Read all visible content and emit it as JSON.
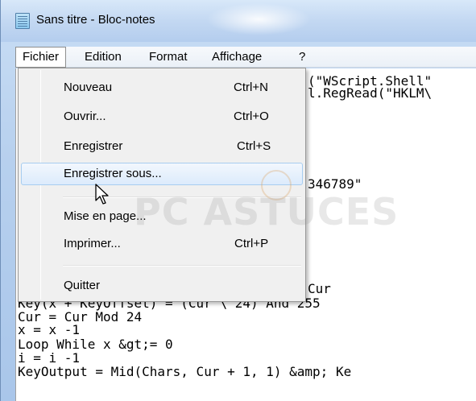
{
  "window": {
    "title": "Sans titre - Bloc-notes"
  },
  "menubar": {
    "items": [
      "Fichier",
      "Edition",
      "Format",
      "Affichage",
      "?"
    ]
  },
  "file_menu": {
    "items": [
      {
        "label": "Nouveau",
        "shortcut": "Ctrl+N"
      },
      {
        "label": "Ouvrir...",
        "shortcut": "Ctrl+O"
      },
      {
        "label": "Enregistrer",
        "shortcut": "Ctrl+S"
      },
      {
        "label": "Enregistrer sous...",
        "shortcut": ""
      },
      {
        "label": "Mise en page...",
        "shortcut": ""
      },
      {
        "label": "Imprimer...",
        "shortcut": "Ctrl+P"
      },
      {
        "label": "Quitter",
        "shortcut": ""
      }
    ],
    "highlighted": "Enregistrer sous..."
  },
  "editor": {
    "lines": [
      "(\"WScript.Shell\"",
      "l.RegRead(\"HKLM\\",
      "346789\"",
      "Cur",
      "Key(x + KeyOffset) = (Cur \\ 24) And 255",
      "Cur = Cur Mod 24",
      "x = x -1",
      "Loop While x &gt;= 0",
      "i = i -1",
      "KeyOutput = Mid(Chars, Cur + 1, 1) &amp; Ke"
    ]
  },
  "watermark": {
    "text": "PC ASTUCES"
  },
  "colors": {
    "titlebar": "#c3d8f2",
    "menu_highlight_border": "#a7cdf0",
    "menu_background": "#f0f0f0"
  }
}
